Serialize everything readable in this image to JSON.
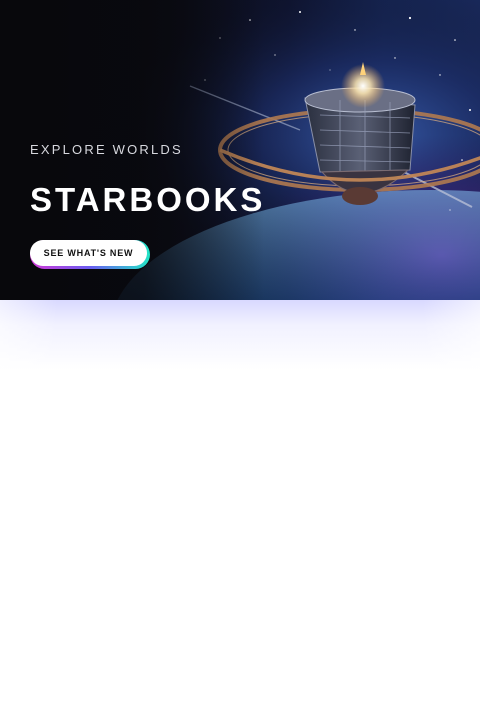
{
  "hero": {
    "eyebrow": "EXPLORE WORLDS",
    "title": "STARBOOKS",
    "cta_label": "SEE WHAT'S NEW",
    "image_subject": "space-station"
  },
  "colors": {
    "hero_background": "#0b0c16",
    "title_text": "#ffffff",
    "eyebrow_text": "#d7d8de",
    "cta_background": "#ffffff",
    "cta_text": "#111111",
    "cta_gradient_start": "#d23ad6",
    "cta_gradient_end": "#22e6c6",
    "glow": "#d6d6ff",
    "page_background": "#ffffff"
  }
}
